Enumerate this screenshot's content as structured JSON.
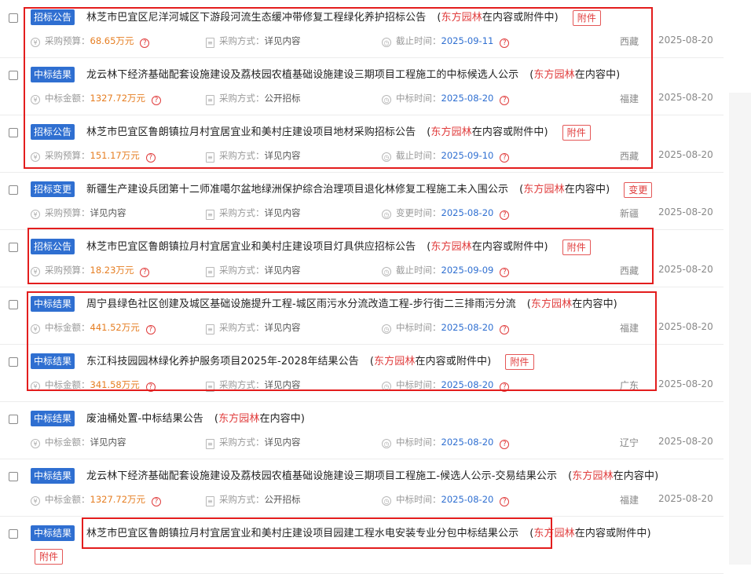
{
  "keyword": "东方园林",
  "meta_labels": {
    "budget": "采购预算：",
    "amount": "中标金额：",
    "method": "采购方式：",
    "deadline": "截止时间：",
    "bid_time": "中标时间：",
    "change_time": "变更时间："
  },
  "rows": [
    {
      "tag": "招标公告",
      "title": "林芝市巴宜区尼洋河城区下游段河流生态缓冲带修复工程绿化养护招标公告",
      "match": "在内容或附件中",
      "badge": "附件",
      "v1": "68.65万元",
      "v2": "详见内容",
      "v3": "2025-09-11",
      "region": "西藏",
      "date": "2025-08-20"
    },
    {
      "tag": "中标结果",
      "title": "龙云林下经济基础配套设施建设及荔枝园农植基础设施建设三期项目工程施工的中标候选人公示",
      "match": "在内容中",
      "badge": "",
      "v1": "1327.72万元",
      "v2": "公开招标",
      "v3": "2025-08-20",
      "region": "福建",
      "date": "2025-08-20"
    },
    {
      "tag": "招标公告",
      "title": "林芝市巴宜区鲁朗镇拉月村宜居宜业和美村庄建设项目地材采购招标公告",
      "match": "在内容或附件中",
      "badge": "附件",
      "v1": "151.17万元",
      "v2": "详见内容",
      "v3": "2025-09-10",
      "region": "西藏",
      "date": "2025-08-20"
    },
    {
      "tag": "招标变更",
      "title": "新疆生产建设兵团第十二师准噶尔盆地绿洲保护综合治理项目退化林修复工程施工未入围公示",
      "match": "在内容中",
      "badge": "变更",
      "v1": "详见内容",
      "v2": "详见内容",
      "v3": "2025-08-20",
      "region": "新疆",
      "date": "2025-08-20"
    },
    {
      "tag": "招标公告",
      "title": "林芝市巴宜区鲁朗镇拉月村宜居宜业和美村庄建设项目灯具供应招标公告",
      "match": "在内容或附件中",
      "badge": "附件",
      "v1": "18.23万元",
      "v2": "详见内容",
      "v3": "2025-09-09",
      "region": "西藏",
      "date": "2025-08-20"
    },
    {
      "tag": "中标结果",
      "title": "周宁县绿色社区创建及城区基础设施提升工程-城区雨污水分流改造工程-步行街二三排雨污分流",
      "match": "在内容中",
      "badge": "",
      "v1": "441.52万元",
      "v2": "详见内容",
      "v3": "2025-08-20",
      "region": "福建",
      "date": "2025-08-20"
    },
    {
      "tag": "中标结果",
      "title": "东江科技园园林绿化养护服务项目2025年-2028年结果公告",
      "match": "在内容或附件中",
      "badge": "附件",
      "v1": "341.58万元",
      "v2": "详见内容",
      "v3": "2025-08-20",
      "region": "广东",
      "date": "2025-08-20"
    },
    {
      "tag": "中标结果",
      "title": "废油桶处置-中标结果公告",
      "match": "在内容中",
      "badge": "",
      "v1": "详见内容",
      "v2": "详见内容",
      "v3": "2025-08-20",
      "region": "辽宁",
      "date": "2025-08-20"
    },
    {
      "tag": "中标结果",
      "title": "龙云林下经济基础配套设施建设及荔枝园农植基础设施建设三期项目工程施工-候选人公示-交易结果公示",
      "match": "在内容中",
      "badge": "",
      "v1": "1327.72万元",
      "v2": "公开招标",
      "v3": "2025-08-20",
      "region": "福建",
      "date": "2025-08-20"
    },
    {
      "tag": "中标结果",
      "title": "林芝市巴宜区鲁朗镇拉月村宜居宜业和美村庄建设项目园建工程水电安装专业分包中标结果公示",
      "match": "在内容或附件中",
      "badge": "附件",
      "v1": "",
      "v2": "",
      "v3": "",
      "region": "",
      "date": ""
    }
  ]
}
